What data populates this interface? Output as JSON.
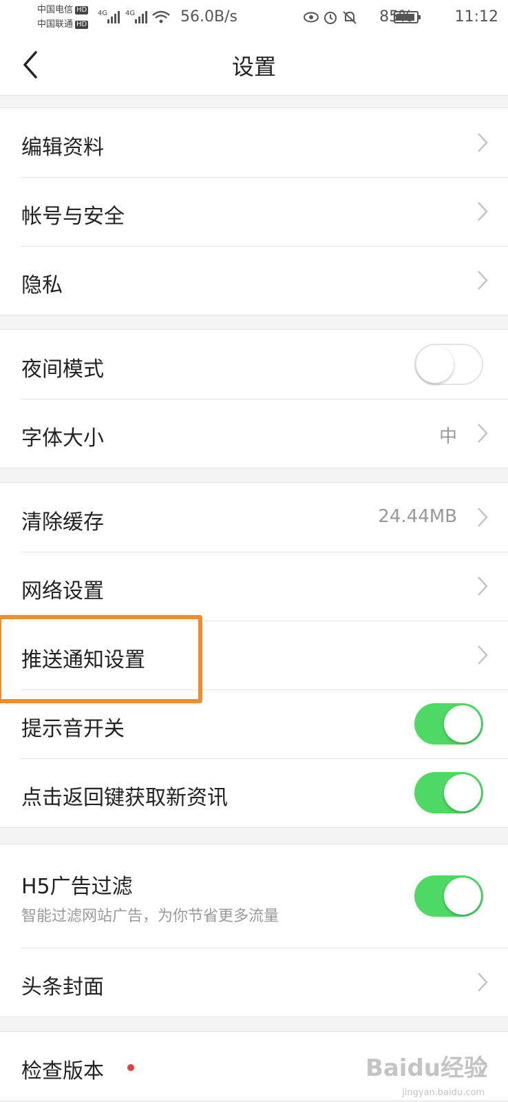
{
  "status_bar": {
    "carrier1": "中国电信",
    "carrier2": "中国联通",
    "hd": "HD",
    "net1": "4G",
    "net2": "4G",
    "speed": "56.0B/s",
    "battery": "85%",
    "time": "11:12",
    "icons": [
      "signal-icon",
      "wifi-icon",
      "eye-icon",
      "alarm-icon",
      "mute-icon",
      "battery-icon"
    ]
  },
  "nav": {
    "title": "设置",
    "back_icon": "chevron-left-icon"
  },
  "groups": {
    "profile": [
      {
        "label": "编辑资料"
      },
      {
        "label": "帐号与安全"
      },
      {
        "label": "隐私"
      }
    ],
    "display": {
      "night_mode": {
        "label": "夜间模式",
        "on": false
      },
      "font_size": {
        "label": "字体大小",
        "value": "中"
      }
    },
    "misc": {
      "clear_cache": {
        "label": "清除缓存",
        "value": "24.44MB"
      },
      "network": {
        "label": "网络设置"
      },
      "push": {
        "label": "推送通知设置"
      },
      "sound": {
        "label": "提示音开关",
        "on": true
      },
      "back_refresh": {
        "label": "点击返回键获取新资讯",
        "on": true
      }
    },
    "h5": {
      "ad_filter": {
        "label": "H5广告过滤",
        "sub": "智能过滤网站广告，为你节省更多流量",
        "on": true
      },
      "cover": {
        "label": "头条封面"
      }
    },
    "version": {
      "label": "检查版本",
      "has_dot": true
    }
  },
  "watermark": {
    "text": "Baidu经验",
    "sub": "jingyan.baidu.com"
  },
  "colors": {
    "toggle_on": "#4cd964",
    "highlight": "#f28a2e",
    "dot": "#e84040"
  }
}
